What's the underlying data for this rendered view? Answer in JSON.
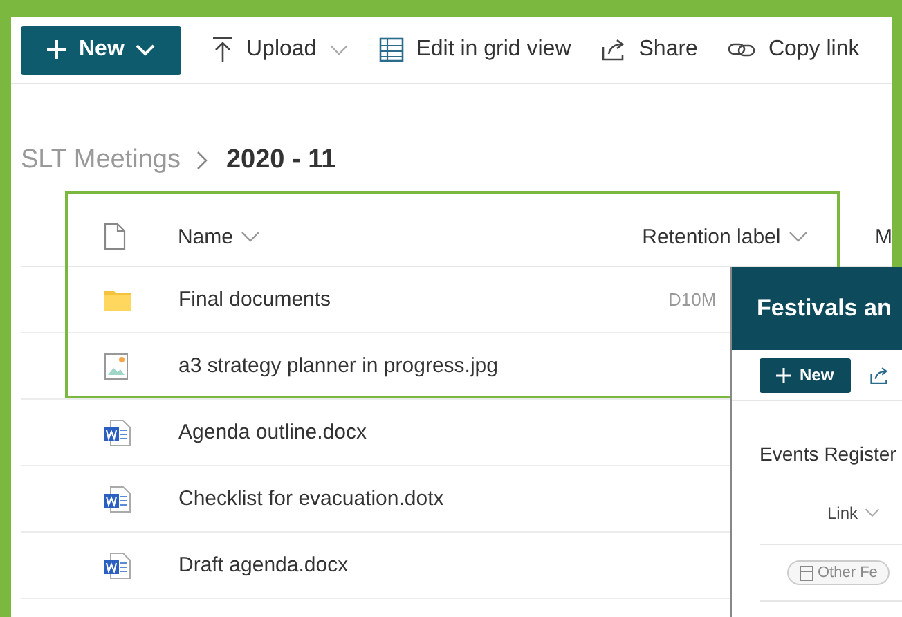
{
  "toolbar": {
    "new_button": {
      "label": "New"
    },
    "items": [
      {
        "kind": "upload",
        "label": "Upload",
        "dropdown": true
      },
      {
        "kind": "grid",
        "label": "Edit in grid view",
        "dropdown": false
      },
      {
        "kind": "share",
        "label": "Share",
        "dropdown": false
      },
      {
        "kind": "link",
        "label": "Copy link",
        "dropdown": false
      }
    ]
  },
  "breadcrumb": [
    {
      "label": "SLT Meetings",
      "current": false
    },
    {
      "label": "2020 - 11",
      "current": true
    }
  ],
  "table": {
    "columns": [
      {
        "label": "Name",
        "sortable": true
      },
      {
        "label": "Retention label",
        "sortable": true
      },
      {
        "label": "M",
        "sortable": false
      }
    ],
    "rows": [
      {
        "kind": "folder",
        "name": "Final documents",
        "retention_label": "D10M",
        "highlighted": true
      },
      {
        "kind": "image",
        "name": "a3 strategy planner in progress.jpg",
        "highlighted": true
      },
      {
        "kind": "word",
        "name": "Agenda outline.docx",
        "highlighted": false
      },
      {
        "kind": "word",
        "name": "Checklist for evacuation.dotx",
        "highlighted": false
      },
      {
        "kind": "word",
        "name": "Draft agenda.docx",
        "highlighted": false
      }
    ]
  },
  "panel": {
    "title": "Festivals an",
    "new_button": "New",
    "section_title": "Events Register",
    "column": "Link",
    "chip": "Other Fe"
  }
}
